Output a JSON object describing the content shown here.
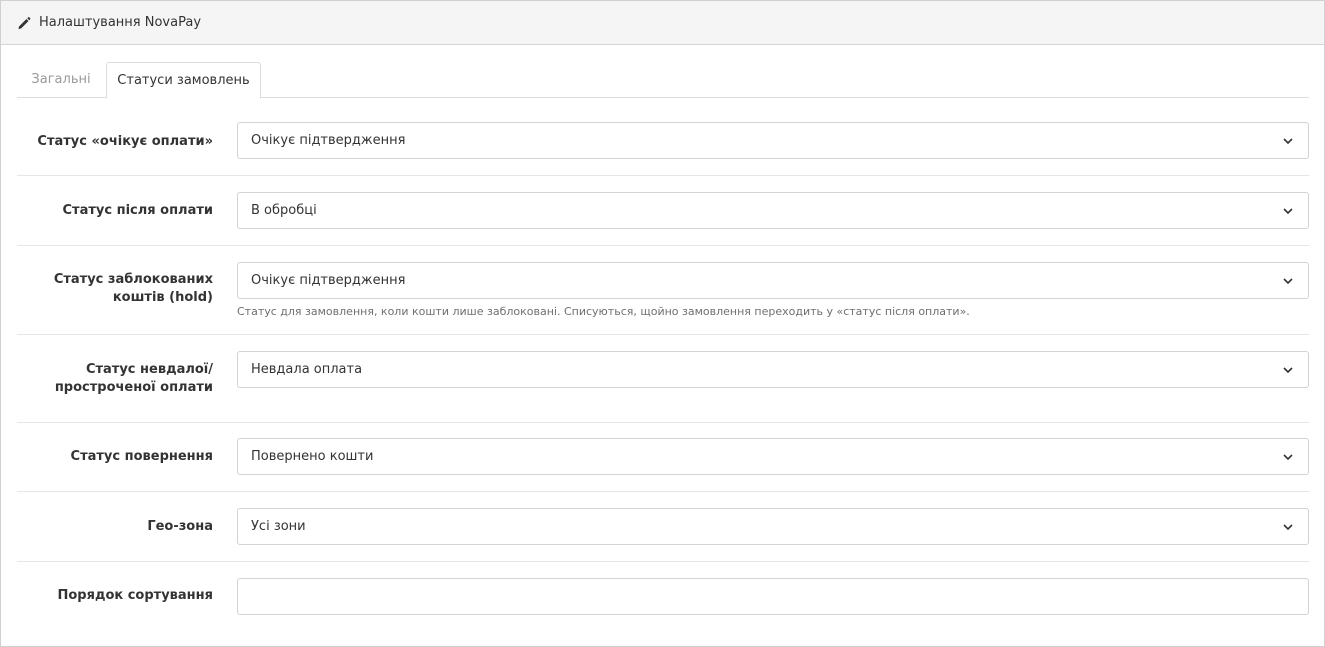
{
  "header": {
    "title": "Налаштування NovaPay",
    "icon": "pencil-icon"
  },
  "tabs": [
    {
      "label": "Загальні",
      "active": false
    },
    {
      "label": "Статуси замовлень",
      "active": true
    }
  ],
  "fields": {
    "pending": {
      "label": "Статус «очікує оплати»",
      "value": "Очікує підтвердження"
    },
    "paid": {
      "label": "Статус після оплати",
      "value": "В обробці"
    },
    "hold": {
      "label_line1": "Статус заблокованих",
      "label_line2": "коштів (hold)",
      "value": "Очікує підтвердження",
      "help": "Статус для замовлення, коли кошти лише заблоковані. Списуються, щойно замовлення переходить у «статус після оплати»."
    },
    "failed": {
      "label_line1": "Статус невдалої/",
      "label_line2": "простроченої оплати",
      "value": "Невдала оплата"
    },
    "refund": {
      "label": "Статус повернення",
      "value": "Повернено кошти"
    },
    "geozone": {
      "label": "Гео-зона",
      "value": "Усі зони"
    },
    "sort": {
      "label": "Порядок сортування",
      "value": ""
    }
  },
  "colors": {
    "border": "#d3d3d3",
    "heading_bg": "#f5f5f5",
    "muted_tab": "#9a9a9a"
  }
}
